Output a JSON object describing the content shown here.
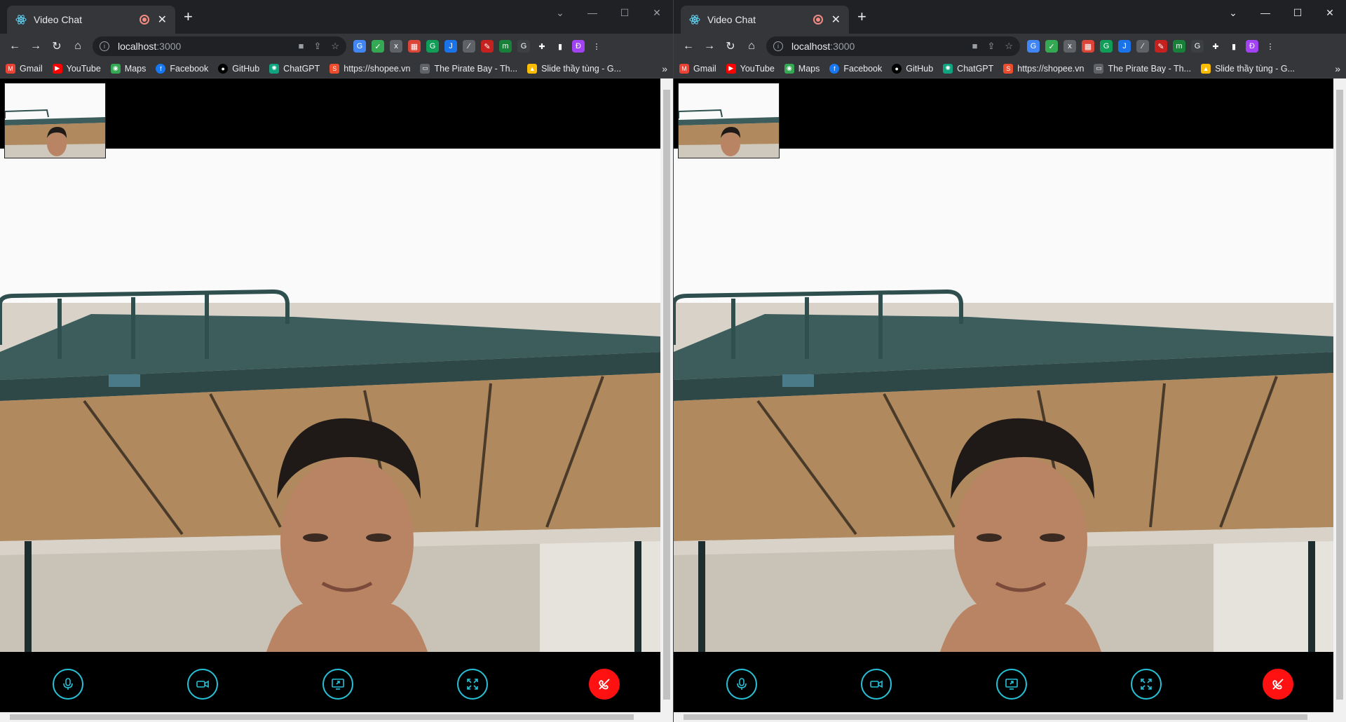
{
  "windows": [
    {
      "id": "left",
      "tab": {
        "title": "Video Chat"
      },
      "address": {
        "host": "localhost",
        "port": ":3000"
      }
    },
    {
      "id": "right",
      "tab": {
        "title": "Video Chat"
      },
      "address": {
        "host": "localhost",
        "port": ":3000"
      }
    }
  ],
  "bookmarks": [
    "Gmail",
    "YouTube",
    "Maps",
    "Facebook",
    "GitHub",
    "ChatGPT",
    "https://shopee.vn",
    "The Pirate Bay - Th...",
    "Slide thầy tùng - G..."
  ],
  "profile_initial": "Đ",
  "controls": [
    "mic-icon",
    "camera-icon",
    "screen-share-icon",
    "fullscreen-icon",
    "end-call-icon"
  ],
  "colors": {
    "control_accent": "#27c1d8",
    "end_call": "#ff1111",
    "chrome_bg": "#202124",
    "toolbar_bg": "#35363a"
  }
}
